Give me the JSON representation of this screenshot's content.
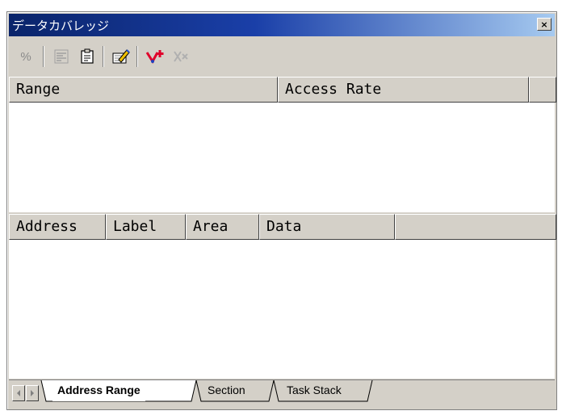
{
  "window": {
    "title": "データカバレッジ",
    "close_glyph": "×"
  },
  "toolbar": {
    "buttons": [
      {
        "icon": "percent-icon",
        "glyph": "%",
        "enabled": false
      },
      {
        "icon": "coverage-settings-icon",
        "enabled": false
      },
      {
        "icon": "clipboard-icon",
        "enabled": true
      },
      {
        "icon": "edit-pencil-icon",
        "enabled": true
      },
      {
        "icon": "add-range-icon",
        "enabled": true
      },
      {
        "icon": "remove-range-icon",
        "enabled": false
      }
    ]
  },
  "range_table": {
    "columns": [
      "Range",
      "Access Rate",
      ""
    ]
  },
  "detail_table": {
    "columns": [
      "Address",
      "Label",
      "Area",
      "Data",
      ""
    ]
  },
  "tabs": {
    "items": [
      "Address Range",
      "Section",
      "Task Stack"
    ],
    "active": "Address Range"
  },
  "colors": {
    "title_start": "#0a246a",
    "title_end": "#a6caf0",
    "face": "#d4d0c8",
    "add_icon_red": "#e0002a"
  }
}
